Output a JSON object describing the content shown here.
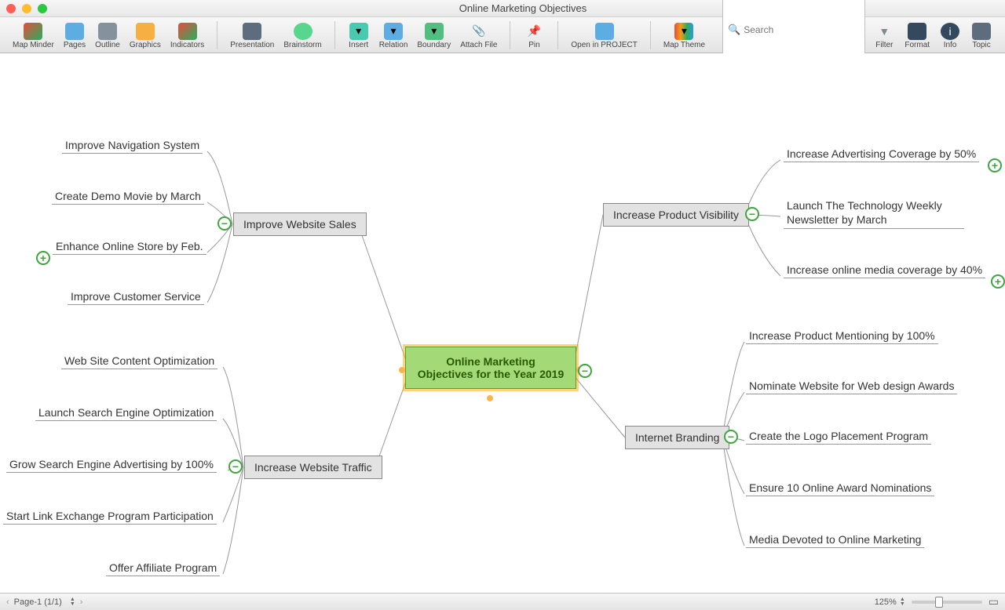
{
  "window": {
    "title": "Online Marketing Objectives"
  },
  "toolbar": {
    "map_minder": "Map Minder",
    "pages": "Pages",
    "outline": "Outline",
    "graphics": "Graphics",
    "indicators": "Indicators",
    "presentation": "Presentation",
    "brainstorm": "Brainstorm",
    "insert": "Insert",
    "relation": "Relation",
    "boundary": "Boundary",
    "attach": "Attach File",
    "pin": "Pin",
    "open_project": "Open in PROJECT",
    "map_theme": "Map Theme",
    "search_label": "Search",
    "search_placeholder": "Search",
    "filter": "Filter",
    "format": "Format",
    "info": "Info",
    "topic": "Topic"
  },
  "mindmap": {
    "central": {
      "line1": "Online Marketing",
      "line2": "Objectives for the Year 2019"
    },
    "improve_sales": {
      "title": "Improve Website Sales",
      "leaves": [
        "Improve Navigation System",
        "Create Demo Movie by March",
        "Enhance Online Store by Feb.",
        "Improve Customer Service"
      ]
    },
    "traffic": {
      "title": "Increase Website Traffic",
      "leaves": [
        "Web Site Content Optimization",
        "Launch Search Engine Optimization",
        "Grow Search Engine Advertising by 100%",
        "Start Link Exchange Program Participation",
        "Offer Affiliate Program"
      ]
    },
    "visibility": {
      "title": "Increase Product Visibility",
      "leaves": [
        "Increase Advertising Coverage by 50%",
        "Launch The Technology Weekly Newsletter by March",
        "Increase online media coverage by 40%"
      ]
    },
    "branding": {
      "title": "Internet Branding",
      "leaves": [
        "Increase Product Mentioning by 100%",
        "Nominate Website for Web design Awards",
        "Create the Logo Placement Program",
        "Ensure 10 Online Award Nominations",
        "Media Devoted to Online Marketing"
      ]
    }
  },
  "status": {
    "page": "Page-1 (1/1)",
    "zoom": "125%"
  }
}
